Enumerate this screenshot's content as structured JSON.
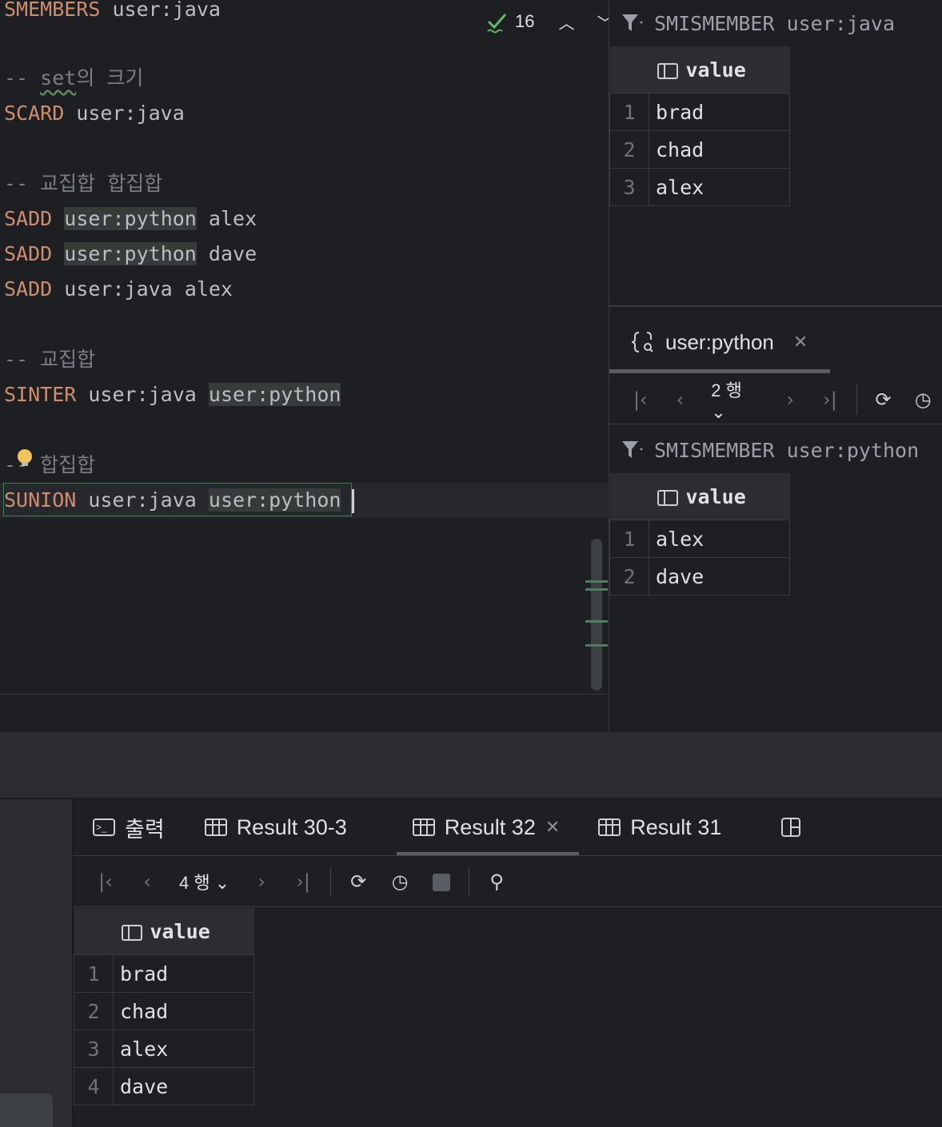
{
  "editor": {
    "lines": {
      "l0_kw": "SMEMBERS",
      "l0_arg": " user:java",
      "l2_cmt_a": "-- ",
      "l2_cmt_b": "set",
      "l2_cmt_c": "의 크기",
      "l3_kw": "SCARD",
      "l3_arg": " user:java",
      "l5_cmt": "-- 교집합 합집합",
      "l6_kw": "SADD",
      "l6_key": "user:python",
      "l6_val": " alex",
      "l7_kw": "SADD",
      "l7_key": "user:python",
      "l7_val": " dave",
      "l8_kw": "SADD",
      "l8_arg": " user:java alex",
      "l10_cmt": "-- 교집합",
      "l11_kw": "SINTER",
      "l11_arg": " user:java ",
      "l11_key": "user:python",
      "l13_cmt": "-- 합집합",
      "l14_kw": "SUNION",
      "l14_arg": " user:java ",
      "l14_key": "user:python"
    },
    "inspection_count": "16"
  },
  "right_pane": {
    "top_filter": "SMISMEMBER user:java",
    "column_header": "value",
    "top_rows": [
      {
        "n": "1",
        "v": "brad"
      },
      {
        "n": "2",
        "v": "chad"
      },
      {
        "n": "3",
        "v": "alex"
      }
    ],
    "python_tab_label": "user:python",
    "rows_label": "2 행",
    "bottom_filter": "SMISMEMBER user:python",
    "bottom_rows": [
      {
        "n": "1",
        "v": "alex"
      },
      {
        "n": "2",
        "v": "dave"
      }
    ]
  },
  "bottom": {
    "tabs": [
      "출력",
      "Result 30-3",
      "Result 32",
      "Result 31"
    ],
    "rows_label": "4 행",
    "column_header": "value",
    "rows": [
      {
        "n": "1",
        "v": "brad"
      },
      {
        "n": "2",
        "v": "chad"
      },
      {
        "n": "3",
        "v": "alex"
      },
      {
        "n": "4",
        "v": "dave"
      }
    ]
  },
  "colors": {
    "keyword": "#cf8e6d",
    "comment": "#7a7e85",
    "background": "#1e1f22"
  }
}
